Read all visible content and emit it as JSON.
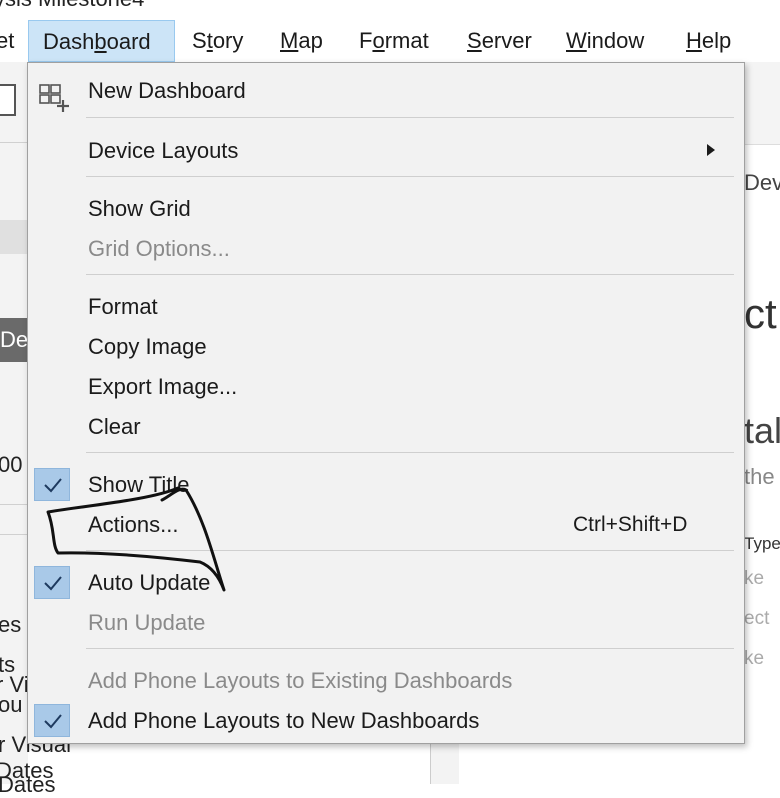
{
  "window": {
    "title_fragment": "ysis Milestone4"
  },
  "menubar": {
    "items": [
      {
        "label": "et",
        "underline": ""
      },
      {
        "label": "Dashboard",
        "underline": "b",
        "active": true
      },
      {
        "label": "Story"
      },
      {
        "label": "Map"
      },
      {
        "label": "Format"
      },
      {
        "label": "Server"
      },
      {
        "label": "Window"
      },
      {
        "label": "Help"
      }
    ]
  },
  "dropdown": {
    "items": [
      {
        "id": "new-dashboard",
        "label": "New Dashboard",
        "icon": "new-dashboard-icon"
      },
      {
        "id": "device-layouts",
        "label": "Device Layouts",
        "submenu": true
      },
      {
        "id": "show-grid",
        "label": "Show Grid"
      },
      {
        "id": "grid-options",
        "label": "Grid Options...",
        "disabled": true
      },
      {
        "id": "format",
        "label": "Format"
      },
      {
        "id": "copy-image",
        "label": "Copy Image"
      },
      {
        "id": "export-image",
        "label": "Export Image..."
      },
      {
        "id": "clear",
        "label": "Clear"
      },
      {
        "id": "show-title",
        "label": "Show Title",
        "checked": true
      },
      {
        "id": "actions",
        "label": "Actions...",
        "shortcut": "Ctrl+Shift+D"
      },
      {
        "id": "auto-update",
        "label": "Auto Update",
        "checked": true
      },
      {
        "id": "run-update",
        "label": "Run Update",
        "disabled": true
      },
      {
        "id": "add-phone-existing",
        "label": "Add Phone Layouts to Existing Dashboards",
        "disabled": true
      },
      {
        "id": "add-phone-new",
        "label": "Add Phone Layouts to New Dashboards",
        "checked": true
      }
    ]
  },
  "background": {
    "left_fragments": [
      "De",
      "00",
      "es",
      "ts",
      "ou",
      "r Visual",
      "Dates"
    ],
    "right_fragments": [
      "Dev",
      "ct",
      "tal",
      "the",
      "Type",
      "ke",
      "ect",
      "ke"
    ]
  },
  "colors": {
    "highlight": "#cce4f7",
    "check_bg": "#a9c9e8",
    "menu_bg": "#f2f2f2",
    "disabled_text": "#8a8a8a"
  }
}
